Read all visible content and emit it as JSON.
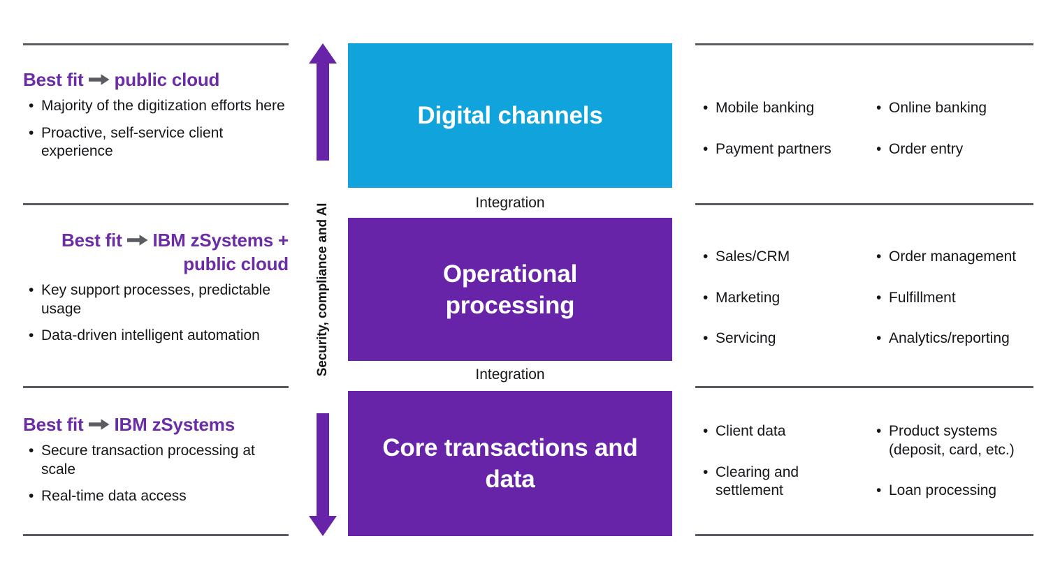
{
  "colors": {
    "purple": "#6724a9",
    "purple_text": "#6b2ca6",
    "blue": "#10a3dc",
    "rule_gray": "#5a5c61",
    "arrow_gray": "#5a5c61",
    "text_black": "#16161a",
    "box_text": "#ffffff"
  },
  "axis": {
    "label": "Security, compliance and AI",
    "direction": "double-headed vertical arrow"
  },
  "tiers": [
    {
      "id": "digital-channels",
      "left": {
        "prefix": "Best fit",
        "arrow": "right-arrow",
        "target": "public cloud",
        "bullets": [
          "Majority of the digitization efforts here",
          "Proactive, self-service client experience"
        ]
      },
      "box": {
        "title": "Digital channels",
        "color": "#10a3dc"
      },
      "connector": "Integration",
      "right": {
        "col1": [
          "Mobile banking",
          "Payment partners"
        ],
        "col2": [
          "Online banking",
          "Order entry"
        ]
      }
    },
    {
      "id": "operational-processing",
      "left": {
        "prefix": "Best fit",
        "arrow": "right-arrow",
        "target": "IBM zSystems + public cloud",
        "bullets": [
          "Key support processes, predictable usage",
          "Data-driven intelligent automation"
        ]
      },
      "box": {
        "title": "Operational processing",
        "color": "#6724a9"
      },
      "connector": "Integration",
      "right": {
        "col1": [
          "Sales/CRM",
          "Marketing",
          "Servicing"
        ],
        "col2": [
          "Order management",
          "Fulfillment",
          "Analytics/reporting"
        ]
      }
    },
    {
      "id": "core-transactions",
      "left": {
        "prefix": "Best fit",
        "arrow": "right-arrow",
        "target": "IBM zSystems",
        "bullets": [
          "Secure transaction processing at scale",
          "Real-time data access"
        ]
      },
      "box": {
        "title": "Core transactions and data",
        "color": "#6724a9"
      },
      "connector": null,
      "right": {
        "col1": [
          "Client data",
          "Clearing and settlement"
        ],
        "col2": [
          "Product systems (deposit, card, etc.)",
          "Loan processing"
        ]
      }
    }
  ]
}
